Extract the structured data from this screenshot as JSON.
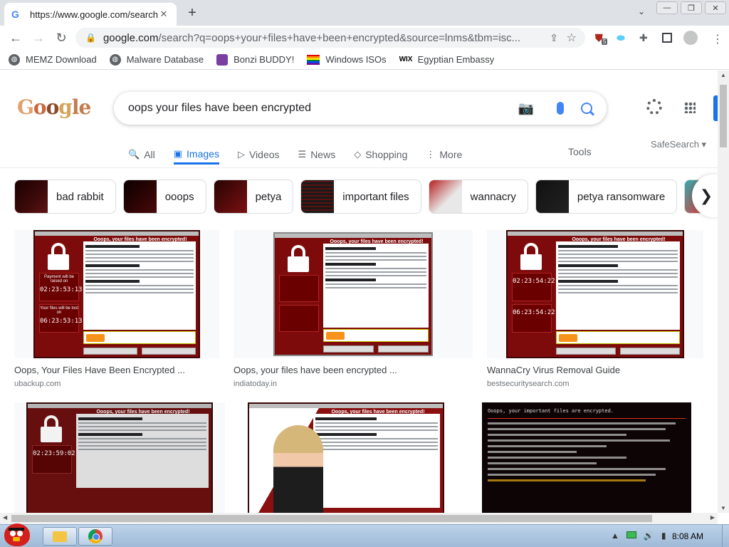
{
  "browser": {
    "tab": {
      "title": "https://www.google.com/search",
      "close": "✕"
    },
    "new_tab": "+",
    "tab_search": "⌄",
    "window_buttons": {
      "minimize": "—",
      "restore": "❐",
      "close": "✕"
    },
    "nav": {
      "back": "←",
      "forward": "→",
      "reload": "↻"
    },
    "address": {
      "host": "google.com",
      "path": "/search?q=oops+your+files+have+been+encrypted&source=lnms&tbm=isc..."
    },
    "extension_badge": "5",
    "bookmarks": [
      {
        "label": "MEMZ Download",
        "icon": "globe-icon"
      },
      {
        "label": "Malware Database",
        "icon": "globe-icon"
      },
      {
        "label": "Bonzi BUDDY!",
        "icon": "bonzi-icon"
      },
      {
        "label": "Windows ISOs",
        "icon": "rainbow-flag-icon"
      },
      {
        "label": "Egyptian Embassy",
        "icon": "wix-icon",
        "icon_text": "WIX"
      }
    ]
  },
  "google": {
    "logo_letters": [
      "G",
      "o",
      "o",
      "g",
      "le"
    ],
    "query": "oops your files have been encrypted",
    "tabs": [
      {
        "label": "All",
        "icon": "search-icon",
        "glyph": "🔍",
        "active": false
      },
      {
        "label": "Images",
        "icon": "image-icon",
        "glyph": "▣",
        "active": true
      },
      {
        "label": "Videos",
        "icon": "video-icon",
        "glyph": "▷",
        "active": false
      },
      {
        "label": "News",
        "icon": "news-icon",
        "glyph": "☰",
        "active": false
      },
      {
        "label": "Shopping",
        "icon": "tag-icon",
        "glyph": "◇",
        "active": false
      },
      {
        "label": "More",
        "icon": "more-icon",
        "glyph": "⋮",
        "active": false
      }
    ],
    "tools": "Tools",
    "safesearch": "SafeSearch ▾",
    "chips": [
      "bad rabbit",
      "ooops",
      "petya",
      "important files",
      "wannacry",
      "petya ransomware"
    ],
    "results": [
      {
        "title": "Oops, Your Files Have Been Encrypted ...",
        "source": "ubackup.com"
      },
      {
        "title": "Oops, your files have been encrypted ...",
        "source": "indiatoday.in"
      },
      {
        "title": "WannaCry Virus Removal Guide",
        "source": "bestsecuritysearch.com"
      },
      {
        "title": "",
        "source": ""
      },
      {
        "title": "",
        "source": ""
      },
      {
        "title": "",
        "source": ""
      }
    ],
    "wannacry": {
      "heading": "Ooops, your files have been encrypted!",
      "timer_top_label": "Payment will be raised on",
      "timer_top_digits": "02:23:53:13",
      "timer_bottom_label": "Your files will be lost on",
      "timer_bottom_digits": "06:23:53:13",
      "digits_variant_2": "02:23:54:22",
      "digits_variant_3": "06:23:54:22",
      "digits_variant_4": "02:23:59:02"
    },
    "dark_result": {
      "heading": "Ooops, your important files are encrypted."
    }
  },
  "taskbar": {
    "clock": "8:08 AM"
  }
}
